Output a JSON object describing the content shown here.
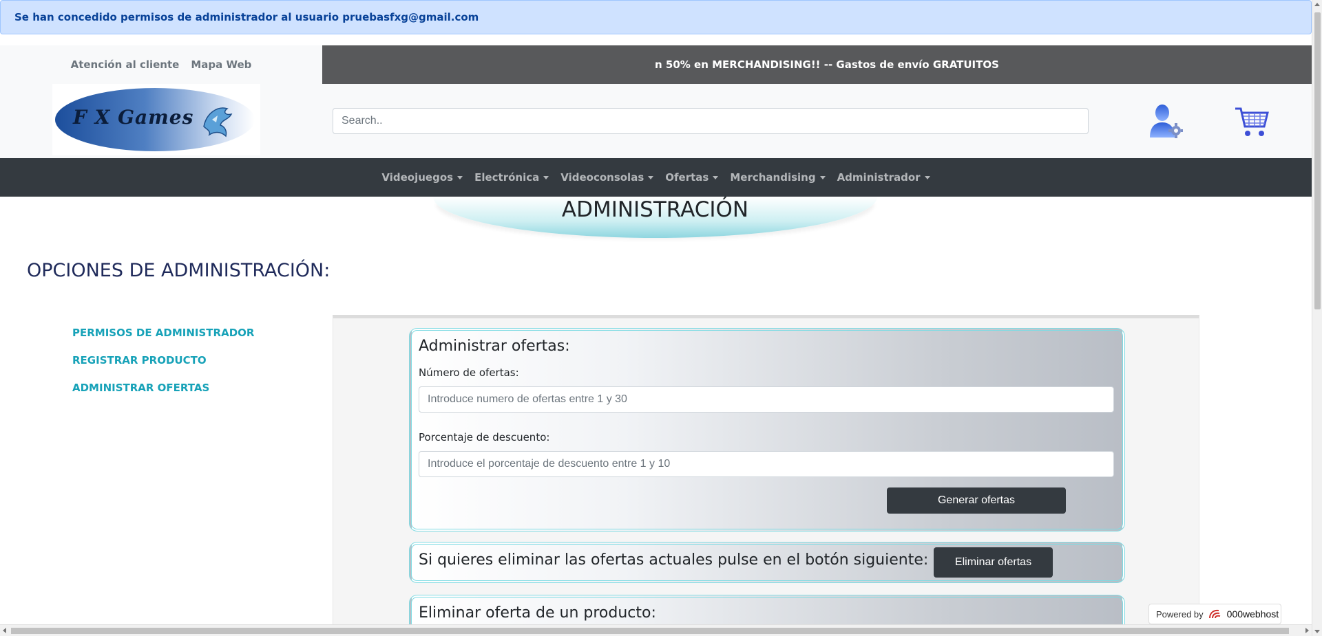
{
  "alert": {
    "message": "Se han concedido permisos de administrador al usuario pruebasfxg@gmail.com"
  },
  "header": {
    "links": [
      "Atención al cliente",
      "Mapa Web"
    ],
    "ticker": "n 50% en MERCHANDISING!! -- Gastos de envío GRATUITOS",
    "logo_text": "F X Games",
    "search_placeholder": "Search..",
    "icons": {
      "admin": "user-gear-icon",
      "cart": "cart-icon"
    }
  },
  "nav": {
    "items": [
      "Videojuegos",
      "Electrónica",
      "Videoconsolas",
      "Ofertas",
      "Merchandising",
      "Administrador"
    ]
  },
  "page": {
    "banner_title": "ADMINISTRACIÓN",
    "section_title": "OPCIONES DE ADMINISTRACIÓN:",
    "sidebar": [
      "PERMISOS DE ADMINISTRADOR",
      "REGISTRAR PRODUCTO",
      "ADMINISTRAR OFERTAS"
    ]
  },
  "offers": {
    "title": "Administrar ofertas:",
    "count_label": "Número de ofertas:",
    "count_placeholder": "Introduce numero de ofertas entre 1 y 30",
    "discount_label": "Porcentaje de descuento:",
    "discount_placeholder": "Introduce el porcentaje de descuento entre 1 y 10",
    "generate_button": "Generar ofertas"
  },
  "remove_offers": {
    "text": "Si quieres eliminar las ofertas actuales pulse en el botón siguiente:",
    "button": "Eliminar ofertas"
  },
  "remove_product_offer": {
    "title": "Eliminar oferta de un producto:"
  },
  "footer_badge": {
    "prefix": "Powered by",
    "brand": "000webhost"
  },
  "colors": {
    "accent": "#17a2b8",
    "nav_bg": "#343a40",
    "alert_bg": "#cfe2ff",
    "card_border": "#7fdbe3"
  }
}
